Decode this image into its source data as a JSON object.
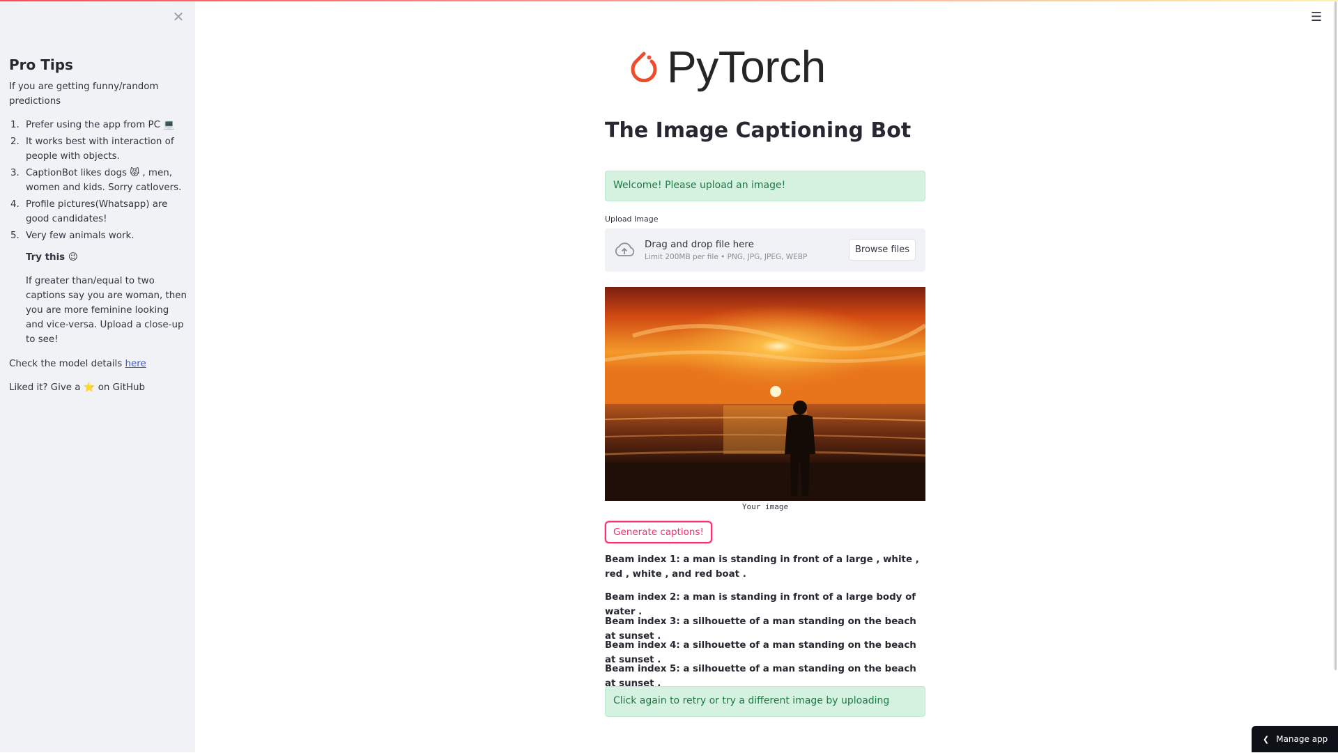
{
  "sidebar": {
    "close_icon": "close-icon",
    "title": "Pro Tips",
    "intro": "If you are getting funny/random predictions",
    "tips": [
      {
        "num": "1.",
        "text": "Prefer using the app from PC 💻"
      },
      {
        "num": "2.",
        "text": "It works best with interaction of people with objects."
      },
      {
        "num": "3.",
        "text": "CaptionBot likes dogs 😾 , men, women and kids. Sorry catlovers."
      },
      {
        "num": "4.",
        "text": "Profile pictures(Whatsapp) are good candidates!"
      },
      {
        "num": "5.",
        "text": "Very few animals work."
      }
    ],
    "try_this": "Try this 😉",
    "try_text": "If greater than/equal to two captions say you are woman, then you are more feminine looking and vice-versa. Upload a close-up to see!",
    "model_prefix": "Check the model details ",
    "model_link": "here",
    "github_text": "Liked it? Give a ⭐ on GitHub"
  },
  "header": {
    "menu_icon": "hamburger-menu-icon"
  },
  "main": {
    "logo_text": "PyTorch",
    "title": "The Image Captioning Bot",
    "welcome_alert": "Welcome! Please upload an image!",
    "upload_label": "Upload Image",
    "drop_title": "Drag and drop file here",
    "drop_sub": "Limit 200MB per file • PNG, JPG, JPEG, WEBP",
    "browse_label": "Browse files",
    "image_caption": "Your image",
    "generate_label": "Generate captions!",
    "beams": [
      "Beam index 1: a man is standing in front of a large , white , red , white , and red boat .",
      "Beam index 2: a man is standing in front of a large body of water .",
      "Beam index 3: a silhouette of a man standing on the beach at sunset .",
      "Beam index 4: a silhouette of a man standing on the beach at sunset .",
      "Beam index 5: a silhouette of a man standing on the beach at sunset ."
    ],
    "retry_alert": "Click again to retry or try a different image by uploading"
  },
  "footer": {
    "manage_label": "Manage app"
  },
  "colors": {
    "accent": "#ff2b6a",
    "success_bg": "#d5f1e0",
    "success_text": "#1e7a43",
    "sidebar_bg": "#f0f2f6",
    "pytorch_orange": "#ee4c2c"
  }
}
